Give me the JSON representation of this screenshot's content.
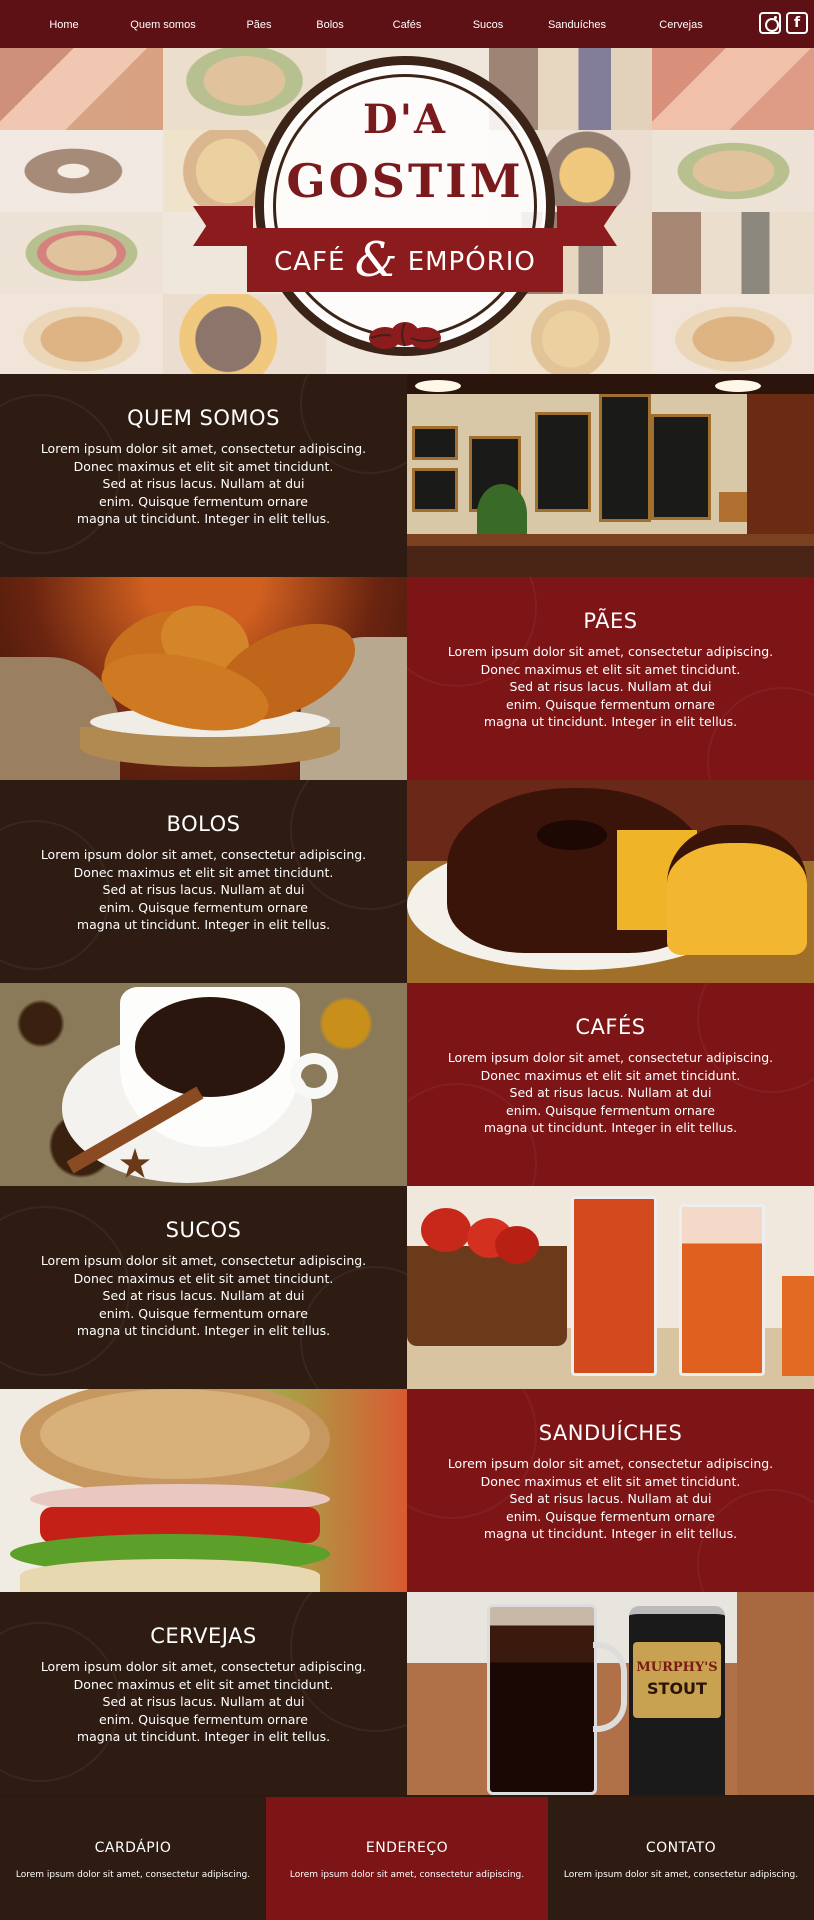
{
  "nav": {
    "items": [
      "Home",
      "Quem somos",
      "Pães",
      "Bolos",
      "Cafés",
      "Sucos",
      "Sanduíches",
      "Cervejas"
    ],
    "social": [
      "instagram-icon",
      "facebook-icon"
    ],
    "facebook_glyph": "f"
  },
  "hero": {
    "logo_top": "D'A",
    "logo_mid": "GOSTIM",
    "ribbon_left": "CAFÉ",
    "ribbon_amp": "&",
    "ribbon_right": "EMPÓRIO"
  },
  "sections": [
    {
      "title": "QUEM SOMOS",
      "body": [
        "Lorem ipsum dolor sit amet, consectetur adipiscing.",
        "Donec maximus et elit sit amet tincidunt.",
        "Sed at risus lacus. Nullam at dui",
        "enim. Quisque fermentum ornare",
        "magna ut tincidunt. Integer in elit tellus."
      ]
    },
    {
      "title": "PÃES",
      "body": [
        "Lorem ipsum dolor sit amet, consectetur adipiscing.",
        "Donec maximus et elit sit amet tincidunt.",
        "Sed at risus lacus. Nullam at dui",
        "enim. Quisque fermentum ornare",
        "magna ut tincidunt. Integer in elit tellus."
      ]
    },
    {
      "title": "BOLOS",
      "body": [
        "Lorem ipsum dolor sit amet, consectetur adipiscing.",
        "Donec maximus et elit sit amet tincidunt.",
        "Sed at risus lacus. Nullam at dui",
        "enim. Quisque fermentum ornare",
        "magna ut tincidunt. Integer in elit tellus."
      ]
    },
    {
      "title": "CAFÉS",
      "body": [
        "Lorem ipsum dolor sit amet, consectetur adipiscing.",
        "Donec maximus et elit sit amet tincidunt.",
        "Sed at risus lacus. Nullam at dui",
        "enim. Quisque fermentum ornare",
        "magna ut tincidunt. Integer in elit tellus."
      ]
    },
    {
      "title": "SUCOS",
      "body": [
        "Lorem ipsum dolor sit amet, consectetur adipiscing.",
        "Donec maximus et elit sit amet tincidunt.",
        "Sed at risus lacus. Nullam at dui",
        "enim. Quisque fermentum ornare",
        "magna ut tincidunt. Integer in elit tellus."
      ]
    },
    {
      "title": "SANDUÍCHES",
      "body": [
        "Lorem ipsum dolor sit amet, consectetur adipiscing.",
        "Donec maximus et elit sit amet tincidunt.",
        "Sed at risus lacus. Nullam at dui",
        "enim. Quisque fermentum ornare",
        "magna ut tincidunt. Integer in elit tellus."
      ]
    },
    {
      "title": "CERVEJAS",
      "body": [
        "Lorem ipsum dolor sit amet, consectetur adipiscing.",
        "Donec maximus et elit sit amet tincidunt.",
        "Sed at risus lacus. Nullam at dui",
        "enim. Quisque fermentum ornare",
        "magna ut tincidunt. Integer in elit tellus."
      ]
    }
  ],
  "photos": {
    "can_brand": "MURPHY'S",
    "can_sub": "STOUT"
  },
  "footer": [
    {
      "title": "CARDÁPIO",
      "text": "Lorem ipsum dolor sit amet, consectetur adipiscing."
    },
    {
      "title": "ENDEREÇO",
      "text": "Lorem ipsum dolor sit amet, consectetur adipiscing."
    },
    {
      "title": "CONTATO",
      "text": "Lorem ipsum dolor sit amet, consectetur adipiscing."
    }
  ],
  "colors": {
    "nav_bg": "#5e1114",
    "dark_panel": "#2e1c12",
    "red_panel": "#7d1416",
    "logo_brown": "#3b2417",
    "logo_red": "#7a1a1c"
  }
}
